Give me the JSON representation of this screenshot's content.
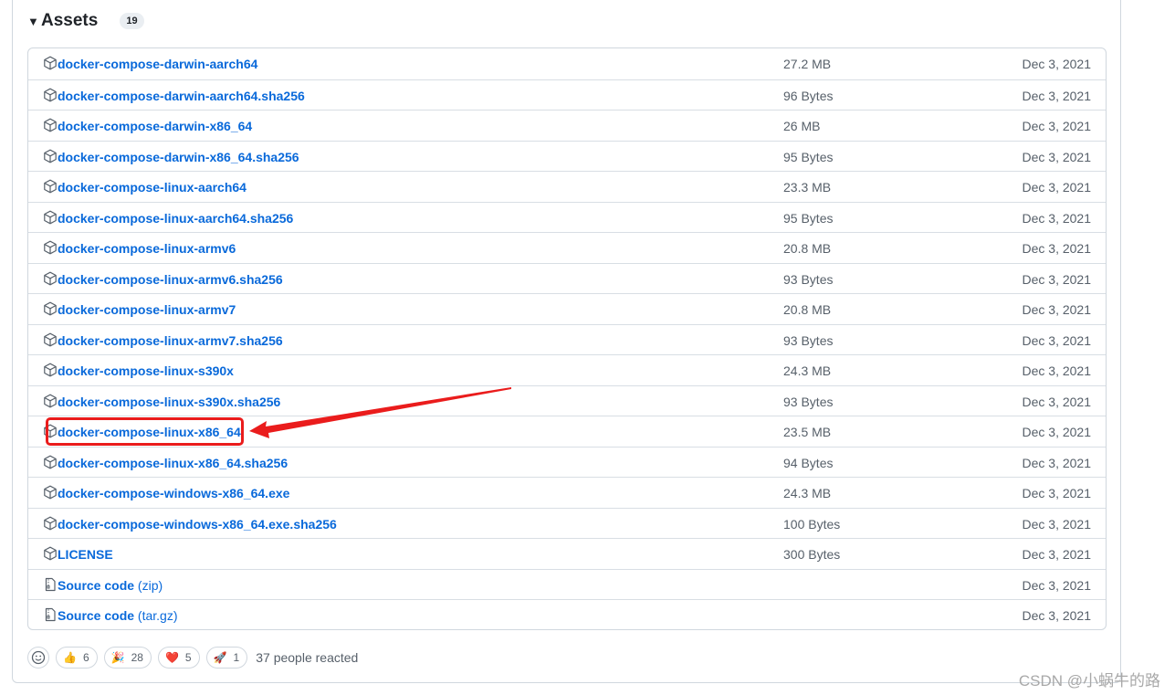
{
  "assets": {
    "title": "Assets",
    "count": "19",
    "items": [
      {
        "name": "docker-compose-darwin-aarch64",
        "suffix": "",
        "size": "27.2 MB",
        "date": "Dec 3, 2021",
        "icon": "package-icon"
      },
      {
        "name": "docker-compose-darwin-aarch64.sha256",
        "suffix": "",
        "size": "96 Bytes",
        "date": "Dec 3, 2021",
        "icon": "package-icon"
      },
      {
        "name": "docker-compose-darwin-x86_64",
        "suffix": "",
        "size": "26 MB",
        "date": "Dec 3, 2021",
        "icon": "package-icon"
      },
      {
        "name": "docker-compose-darwin-x86_64.sha256",
        "suffix": "",
        "size": "95 Bytes",
        "date": "Dec 3, 2021",
        "icon": "package-icon"
      },
      {
        "name": "docker-compose-linux-aarch64",
        "suffix": "",
        "size": "23.3 MB",
        "date": "Dec 3, 2021",
        "icon": "package-icon"
      },
      {
        "name": "docker-compose-linux-aarch64.sha256",
        "suffix": "",
        "size": "95 Bytes",
        "date": "Dec 3, 2021",
        "icon": "package-icon"
      },
      {
        "name": "docker-compose-linux-armv6",
        "suffix": "",
        "size": "20.8 MB",
        "date": "Dec 3, 2021",
        "icon": "package-icon"
      },
      {
        "name": "docker-compose-linux-armv6.sha256",
        "suffix": "",
        "size": "93 Bytes",
        "date": "Dec 3, 2021",
        "icon": "package-icon"
      },
      {
        "name": "docker-compose-linux-armv7",
        "suffix": "",
        "size": "20.8 MB",
        "date": "Dec 3, 2021",
        "icon": "package-icon"
      },
      {
        "name": "docker-compose-linux-armv7.sha256",
        "suffix": "",
        "size": "93 Bytes",
        "date": "Dec 3, 2021",
        "icon": "package-icon"
      },
      {
        "name": "docker-compose-linux-s390x",
        "suffix": "",
        "size": "24.3 MB",
        "date": "Dec 3, 2021",
        "icon": "package-icon"
      },
      {
        "name": "docker-compose-linux-s390x.sha256",
        "suffix": "",
        "size": "93 Bytes",
        "date": "Dec 3, 2021",
        "icon": "package-icon"
      },
      {
        "name": "docker-compose-linux-x86_64",
        "suffix": "",
        "size": "23.5 MB",
        "date": "Dec 3, 2021",
        "icon": "package-icon"
      },
      {
        "name": "docker-compose-linux-x86_64.sha256",
        "suffix": "",
        "size": "94 Bytes",
        "date": "Dec 3, 2021",
        "icon": "package-icon"
      },
      {
        "name": "docker-compose-windows-x86_64.exe",
        "suffix": "",
        "size": "24.3 MB",
        "date": "Dec 3, 2021",
        "icon": "package-icon"
      },
      {
        "name": "docker-compose-windows-x86_64.exe.sha256",
        "suffix": "",
        "size": "100 Bytes",
        "date": "Dec 3, 2021",
        "icon": "package-icon"
      },
      {
        "name": "LICENSE",
        "suffix": "",
        "size": "300 Bytes",
        "date": "Dec 3, 2021",
        "icon": "package-icon"
      },
      {
        "name": "Source code",
        "suffix": " (zip)",
        "size": "",
        "date": "Dec 3, 2021",
        "icon": "file-zip-icon"
      },
      {
        "name": "Source code",
        "suffix": " (tar.gz)",
        "size": "",
        "date": "Dec 3, 2021",
        "icon": "file-zip-icon"
      }
    ]
  },
  "reactions": {
    "items": [
      {
        "emoji": "👍",
        "count": "6",
        "icon": "thumbs-up-icon"
      },
      {
        "emoji": "🎉",
        "count": "28",
        "icon": "party-icon"
      },
      {
        "emoji": "❤️",
        "count": "5",
        "icon": "heart-icon"
      },
      {
        "emoji": "🚀",
        "count": "1",
        "icon": "rocket-icon"
      }
    ],
    "summary": "37 people reacted"
  },
  "watermark": "CSDN @小蜗牛的路",
  "colors": {
    "link": "#0969da",
    "annotation": "#ea1c1c",
    "muted": "#57606a"
  }
}
